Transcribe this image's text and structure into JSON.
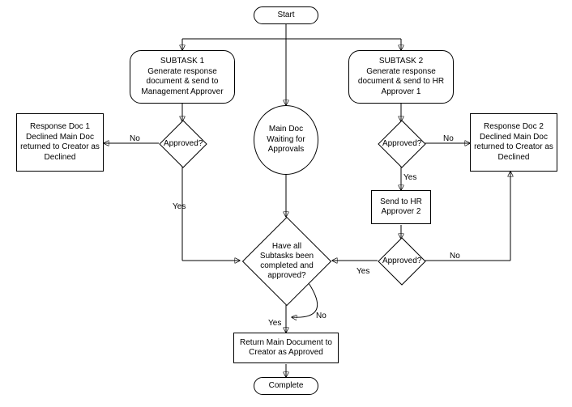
{
  "chart_data": {
    "type": "flowchart",
    "nodes": [
      {
        "id": "start",
        "shape": "terminator",
        "label": "Start"
      },
      {
        "id": "subtask1",
        "shape": "process-rounded",
        "label": "SUBTASK 1\nGenerate response document & send to Management Approver"
      },
      {
        "id": "subtask2",
        "shape": "process-rounded",
        "label": "SUBTASK 2\nGenerate response document & send to HR Approver 1"
      },
      {
        "id": "mainDocWait",
        "shape": "circle",
        "label": "Main Doc Waiting for Approvals"
      },
      {
        "id": "approved1",
        "shape": "decision",
        "label": "Approved?"
      },
      {
        "id": "approved2",
        "shape": "decision",
        "label": "Approved?"
      },
      {
        "id": "declined1",
        "shape": "process",
        "label": "Response Doc 1 Declined Main Doc returned to Creator as Declined"
      },
      {
        "id": "declined2",
        "shape": "process",
        "label": "Response Doc 2 Declined Main Doc returned to Creator as Declined"
      },
      {
        "id": "sendHR2",
        "shape": "process",
        "label": "Send to HR Approver 2"
      },
      {
        "id": "approved3",
        "shape": "decision",
        "label": "Approved?"
      },
      {
        "id": "allComplete",
        "shape": "decision",
        "label": "Have all Subtasks been completed and approved?"
      },
      {
        "id": "returnApproved",
        "shape": "process",
        "label": "Return Main Document to Creator as Approved"
      },
      {
        "id": "complete",
        "shape": "terminator",
        "label": "Complete"
      }
    ],
    "edges": [
      {
        "from": "start",
        "to": "subtask1"
      },
      {
        "from": "start",
        "to": "subtask2"
      },
      {
        "from": "start",
        "to": "mainDocWait"
      },
      {
        "from": "subtask1",
        "to": "approved1"
      },
      {
        "from": "approved1",
        "to": "declined1",
        "label": "No"
      },
      {
        "from": "approved1",
        "to": "allComplete",
        "label": "Yes"
      },
      {
        "from": "subtask2",
        "to": "approved2"
      },
      {
        "from": "approved2",
        "to": "declined2",
        "label": "No"
      },
      {
        "from": "approved2",
        "to": "sendHR2",
        "label": "Yes"
      },
      {
        "from": "sendHR2",
        "to": "approved3"
      },
      {
        "from": "approved3",
        "to": "declined2",
        "label": "No"
      },
      {
        "from": "approved3",
        "to": "allComplete",
        "label": "Yes"
      },
      {
        "from": "mainDocWait",
        "to": "allComplete"
      },
      {
        "from": "allComplete",
        "to": "allComplete",
        "label": "No"
      },
      {
        "from": "allComplete",
        "to": "returnApproved",
        "label": "Yes"
      },
      {
        "from": "returnApproved",
        "to": "complete"
      }
    ]
  },
  "labels": {
    "start": "Start",
    "subtask1_title": "SUBTASK 1",
    "subtask1_body": "Generate response document & send to Management Approver",
    "subtask2_title": "SUBTASK 2",
    "subtask2_body": "Generate response document & send to HR Approver 1",
    "mainDocWait": "Main Doc Waiting for Approvals",
    "approved": "Approved?",
    "declined1": "Response Doc 1 Declined Main Doc returned to Creator as Declined",
    "declined2": "Response Doc 2 Declined Main Doc returned to Creator as Declined",
    "sendHR2": "Send to HR Approver 2",
    "allComplete": "Have all Subtasks been completed and approved?",
    "returnApproved": "Return Main Document to Creator as Approved",
    "complete": "Complete",
    "yes": "Yes",
    "no": "No"
  }
}
